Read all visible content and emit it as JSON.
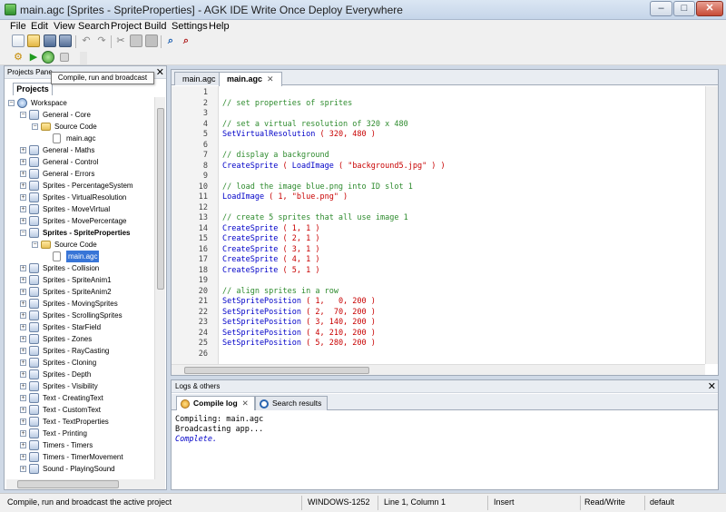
{
  "window": {
    "title": "main.agc [Sprites - SpriteProperties] - AGK IDE Write Once Deploy Everywhere",
    "minimize_glyph": "–",
    "maximize_glyph": "□",
    "close_glyph": "✕"
  },
  "menu": [
    "File",
    "Edit",
    "View",
    "Search",
    "Project",
    "Build",
    "Settings",
    "Help"
  ],
  "toolbar": {
    "icons": [
      "new-file-icon",
      "open-file-icon",
      "save-icon",
      "save-all-icon",
      "undo-icon",
      "redo-icon",
      "cut-icon",
      "copy-icon",
      "paste-icon",
      "find-icon",
      "find-replace-icon"
    ],
    "run_icons": [
      "compile-icon",
      "run-icon",
      "broadcast-icon",
      "stop-icon"
    ]
  },
  "tooltip": "Compile, run and broadcast",
  "projects_panel": {
    "title": "Projects Pane",
    "close_glyph": "✕",
    "tab": "Projects",
    "tree": [
      {
        "label": "Workspace",
        "level": 0,
        "kind": "ws",
        "expander": "−"
      },
      {
        "label": "General - Core",
        "level": 1,
        "kind": "proj",
        "expander": "−"
      },
      {
        "label": "Source Code",
        "level": 2,
        "kind": "folder",
        "expander": "−"
      },
      {
        "label": "main.agc",
        "level": 3,
        "kind": "file"
      },
      {
        "label": "General - Maths",
        "level": 1,
        "kind": "proj",
        "expander": "+"
      },
      {
        "label": "General - Control",
        "level": 1,
        "kind": "proj",
        "expander": "+"
      },
      {
        "label": "General - Errors",
        "level": 1,
        "kind": "proj",
        "expander": "+"
      },
      {
        "label": "Sprites - PercentageSystem",
        "level": 1,
        "kind": "proj",
        "expander": "+"
      },
      {
        "label": "Sprites - VirtualResolution",
        "level": 1,
        "kind": "proj",
        "expander": "+"
      },
      {
        "label": "Sprites - MoveVirtual",
        "level": 1,
        "kind": "proj",
        "expander": "+"
      },
      {
        "label": "Sprites - MovePercentage",
        "level": 1,
        "kind": "proj",
        "expander": "+"
      },
      {
        "label": "Sprites - SpriteProperties",
        "level": 1,
        "kind": "proj",
        "expander": "−",
        "bold": true
      },
      {
        "label": "Source Code",
        "level": 2,
        "kind": "folder",
        "expander": "−"
      },
      {
        "label": "main.agc",
        "level": 3,
        "kind": "file",
        "selected": true
      },
      {
        "label": "Sprites - Collision",
        "level": 1,
        "kind": "proj",
        "expander": "+"
      },
      {
        "label": "Sprites - SpriteAnim1",
        "level": 1,
        "kind": "proj",
        "expander": "+"
      },
      {
        "label": "Sprites - SpriteAnim2",
        "level": 1,
        "kind": "proj",
        "expander": "+"
      },
      {
        "label": "Sprites - MovingSprites",
        "level": 1,
        "kind": "proj",
        "expander": "+"
      },
      {
        "label": "Sprites - ScrollingSprites",
        "level": 1,
        "kind": "proj",
        "expander": "+"
      },
      {
        "label": "Sprites - StarField",
        "level": 1,
        "kind": "proj",
        "expander": "+"
      },
      {
        "label": "Sprites - Zones",
        "level": 1,
        "kind": "proj",
        "expander": "+"
      },
      {
        "label": "Sprites - RayCasting",
        "level": 1,
        "kind": "proj",
        "expander": "+"
      },
      {
        "label": "Sprites - Cloning",
        "level": 1,
        "kind": "proj",
        "expander": "+"
      },
      {
        "label": "Sprites - Depth",
        "level": 1,
        "kind": "proj",
        "expander": "+"
      },
      {
        "label": "Sprites - Visibility",
        "level": 1,
        "kind": "proj",
        "expander": "+"
      },
      {
        "label": "Text - CreatingText",
        "level": 1,
        "kind": "proj",
        "expander": "+"
      },
      {
        "label": "Text - CustomText",
        "level": 1,
        "kind": "proj",
        "expander": "+"
      },
      {
        "label": "Text - TextProperties",
        "level": 1,
        "kind": "proj",
        "expander": "+"
      },
      {
        "label": "Text - Printing",
        "level": 1,
        "kind": "proj",
        "expander": "+"
      },
      {
        "label": "Timers - Timers",
        "level": 1,
        "kind": "proj",
        "expander": "+"
      },
      {
        "label": "Timers - TimerMovement",
        "level": 1,
        "kind": "proj",
        "expander": "+"
      },
      {
        "label": "Sound - PlayingSound",
        "level": 1,
        "kind": "proj",
        "expander": "+"
      }
    ]
  },
  "editor": {
    "tabs": [
      {
        "label": "main.agc",
        "active": false
      },
      {
        "label": "main.agc",
        "active": true,
        "close": "✕"
      }
    ],
    "lines": [
      {
        "n": "1",
        "parts": []
      },
      {
        "n": "2",
        "parts": [
          {
            "t": "// set properties of sprites",
            "c": "cm"
          }
        ]
      },
      {
        "n": "3",
        "parts": []
      },
      {
        "n": "4",
        "parts": [
          {
            "t": "// set a virtual resolution of 320 x 480",
            "c": "cm"
          }
        ]
      },
      {
        "n": "5",
        "parts": [
          {
            "t": "SetVirtualResolution",
            "c": "kw"
          },
          {
            "t": " ( 320, 480 )",
            "c": "ps"
          }
        ]
      },
      {
        "n": "6",
        "parts": []
      },
      {
        "n": "7",
        "parts": [
          {
            "t": "// display a background",
            "c": "cm"
          }
        ]
      },
      {
        "n": "8",
        "parts": [
          {
            "t": "CreateSprite",
            "c": "kw"
          },
          {
            "t": " ( ",
            "c": "ps"
          },
          {
            "t": "LoadImage",
            "c": "kw"
          },
          {
            "t": " ( \"background5.jpg\" ) )",
            "c": "ps"
          }
        ]
      },
      {
        "n": "9",
        "parts": []
      },
      {
        "n": "10",
        "parts": [
          {
            "t": "// load the image blue.png into ID slot 1",
            "c": "cm"
          }
        ]
      },
      {
        "n": "11",
        "parts": [
          {
            "t": "LoadImage",
            "c": "kw"
          },
          {
            "t": " ( 1, \"blue.png\" )",
            "c": "ps"
          }
        ]
      },
      {
        "n": "12",
        "parts": []
      },
      {
        "n": "13",
        "parts": [
          {
            "t": "// create 5 sprites that all use image 1",
            "c": "cm"
          }
        ]
      },
      {
        "n": "14",
        "parts": [
          {
            "t": "CreateSprite",
            "c": "kw"
          },
          {
            "t": " ( 1, 1 )",
            "c": "ps"
          }
        ]
      },
      {
        "n": "15",
        "parts": [
          {
            "t": "CreateSprite",
            "c": "kw"
          },
          {
            "t": " ( 2, 1 )",
            "c": "ps"
          }
        ]
      },
      {
        "n": "16",
        "parts": [
          {
            "t": "CreateSprite",
            "c": "kw"
          },
          {
            "t": " ( 3, 1 )",
            "c": "ps"
          }
        ]
      },
      {
        "n": "17",
        "parts": [
          {
            "t": "CreateSprite",
            "c": "kw"
          },
          {
            "t": " ( 4, 1 )",
            "c": "ps"
          }
        ]
      },
      {
        "n": "18",
        "parts": [
          {
            "t": "CreateSprite",
            "c": "kw"
          },
          {
            "t": " ( 5, 1 )",
            "c": "ps"
          }
        ]
      },
      {
        "n": "19",
        "parts": []
      },
      {
        "n": "20",
        "parts": [
          {
            "t": "// align sprites in a row",
            "c": "cm"
          }
        ]
      },
      {
        "n": "21",
        "parts": [
          {
            "t": "SetSpritePosition",
            "c": "kw"
          },
          {
            "t": " ( 1,   0, 200 )",
            "c": "ps"
          }
        ]
      },
      {
        "n": "22",
        "parts": [
          {
            "t": "SetSpritePosition",
            "c": "kw"
          },
          {
            "t": " ( 2,  70, 200 )",
            "c": "ps"
          }
        ]
      },
      {
        "n": "23",
        "parts": [
          {
            "t": "SetSpritePosition",
            "c": "kw"
          },
          {
            "t": " ( 3, 140, 200 )",
            "c": "ps"
          }
        ]
      },
      {
        "n": "24",
        "parts": [
          {
            "t": "SetSpritePosition",
            "c": "kw"
          },
          {
            "t": " ( 4, 210, 200 )",
            "c": "ps"
          }
        ]
      },
      {
        "n": "25",
        "parts": [
          {
            "t": "SetSpritePosition",
            "c": "kw"
          },
          {
            "t": " ( 5, 280, 200 )",
            "c": "ps"
          }
        ]
      },
      {
        "n": "26",
        "parts": []
      }
    ]
  },
  "logs": {
    "title": "Logs & others",
    "close_glyph": "✕",
    "tabs": [
      {
        "label": "Compile log",
        "active": true,
        "close": "✕",
        "icon": "compile-log-icon"
      },
      {
        "label": "Search results",
        "active": false,
        "icon": "search-results-icon"
      }
    ],
    "lines": [
      {
        "t": "Compiling: main.agc",
        "color": "#000000"
      },
      {
        "t": "Broadcasting app...",
        "color": "#000000"
      },
      {
        "t": "Complete.",
        "color": "#0000c8",
        "italic": true
      }
    ]
  },
  "status": {
    "message": "Compile, run and broadcast the active project",
    "encoding": "WINDOWS-1252",
    "position": "Line 1, Column 1",
    "mode": "Insert",
    "access": "Read/Write",
    "profile": "default"
  },
  "colors": {
    "keyword": "#0000c8",
    "comment": "#2e8b2e",
    "params": "#c80000",
    "selection": "#3875d7"
  }
}
